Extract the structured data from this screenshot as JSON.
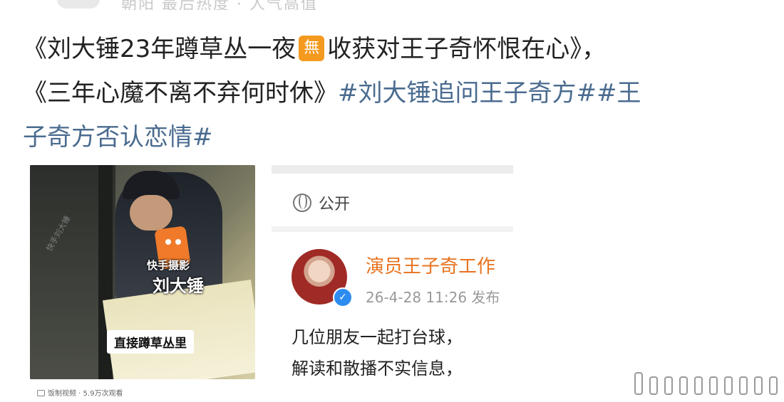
{
  "top_strip": {
    "text": "朝阳 最后热度 · 人气高值"
  },
  "post": {
    "line1_part1": "《刘大锤23年蹲草丛一夜",
    "emoji_text": "無",
    "line1_part2": "收获对王子奇怀恨在心》，",
    "line2_plain": "《三年心魔不离不弃何时休》",
    "line2_tag": "#刘大锤追问王子奇方##王",
    "line3_tag": "子奇方否认恋情#"
  },
  "video": {
    "caption_small": "快手摄影",
    "caption_name": "刘大锤",
    "subtitle": "直接蹲草丛里",
    "watermark": "快手刘大锤",
    "meta_source": "饭制视频",
    "meta_views": "5.9万次观看"
  },
  "screenshot": {
    "visibility": "公开",
    "account_name": "演员王子奇工作",
    "timestamp": "26-4-28 11:26  发布",
    "body_line1": "几位朋友一起打台球，",
    "body_line2": "解读和散播不实信息，"
  },
  "colors": {
    "hashtag": "#4a6b8f",
    "account_name": "#e8731f",
    "emoji_badge": "#f39a1f"
  }
}
